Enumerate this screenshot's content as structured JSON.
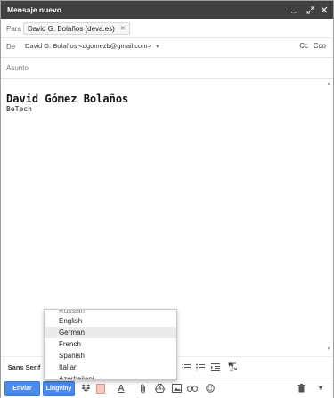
{
  "window": {
    "title": "Mensaje nuevo",
    "controls": [
      "minimize-icon",
      "expand-icon",
      "close-icon"
    ]
  },
  "to": {
    "label": "Para",
    "recipient": "David G. Bolaños (deva.es)"
  },
  "from": {
    "label": "De",
    "value": "David G. Bolaños <dgomezb@gmail.com>",
    "cc": "Cc",
    "bcc": "Cco"
  },
  "subject": {
    "placeholder": "Asunto"
  },
  "body": {
    "name": "David Gómez Bolaños",
    "company": "BeTech"
  },
  "formatting": {
    "font": "Sans Serif",
    "icons": [
      "numbered-list-icon",
      "bulleted-list-icon",
      "indent-less-icon",
      "indent-more-icon",
      "quote-icon",
      "remove-formatting-icon"
    ]
  },
  "toolbar": {
    "send_label": "Enviar",
    "lingviny_label": "Lingviny",
    "accent": "#4a8bf0"
  },
  "language_menu": {
    "items": [
      "Russian",
      "English",
      "German",
      "French",
      "Spanish",
      "Italian",
      "Azerbaijani"
    ],
    "selected": "German"
  }
}
